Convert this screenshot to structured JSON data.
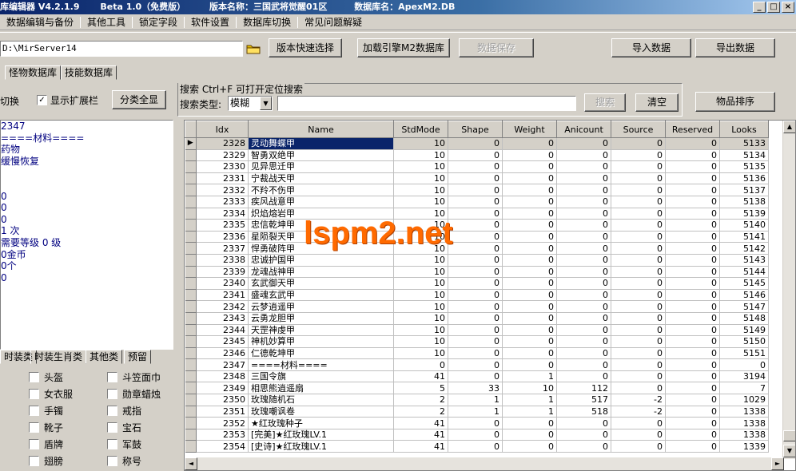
{
  "titlebar": {
    "app": "库编辑器 V4.2.1.9",
    "beta": "Beta 1.0（免费版）",
    "version": "版本名称：三国武将觉醒01区",
    "db": "数据库名：ApexM2.DB",
    "min": "_",
    "max": "□",
    "close": "×"
  },
  "menu": [
    "数据编辑与备份",
    "其他工具",
    "锁定字段",
    "软件设置",
    "数据库切换",
    "常见问题解疑"
  ],
  "toolbar": {
    "path": "D:\\MirServer14",
    "quick_select": "版本快速选择",
    "load_engine": "加载引擎M2数据库",
    "save_data": "数据保存",
    "import": "导入数据",
    "export": "导出数据"
  },
  "tabs": [
    "怪物数据库",
    "技能数据库"
  ],
  "left_top": {
    "switch_label": "切换",
    "show_ext": "显示扩展栏",
    "show_ext_checked": "✓",
    "show_all": "分类全显"
  },
  "search": {
    "title": "搜索  Ctrl+F 可打开定位搜索",
    "type_label": "搜索类型:",
    "type_value": "模糊",
    "search_btn": "搜索",
    "clear_btn": "清空",
    "sort_btn": "物品排序"
  },
  "info_lines": [
    "2347",
    "====材料====",
    "药物",
    "缓慢恢复",
    "",
    "",
    "0",
    "0",
    "0",
    "1 次",
    "需要等级 0 级",
    "0金币",
    "0个",
    "0"
  ],
  "bottom_tabs": [
    "时装类",
    "时装生肖类",
    "其他类",
    "预留"
  ],
  "checklist": {
    "left": [
      "头盔",
      "女衣服",
      "手镯",
      "靴子",
      "盾牌",
      "翅膀"
    ],
    "right": [
      "斗笠面巾",
      "勋章蜡烛",
      "戒指",
      "宝石",
      "军鼓",
      "称号"
    ]
  },
  "grid": {
    "columns": [
      "Idx",
      "Name",
      "StdMode",
      "Shape",
      "Weight",
      "Anicount",
      "Source",
      "Reserved",
      "Looks"
    ],
    "rows": [
      [
        "2328",
        "灵动舞蝶甲",
        "10",
        "0",
        "0",
        "0",
        "0",
        "0",
        "5133"
      ],
      [
        "2329",
        "智勇双绝甲",
        "10",
        "0",
        "0",
        "0",
        "0",
        "0",
        "5134"
      ],
      [
        "2330",
        "见异思迁甲",
        "10",
        "0",
        "0",
        "0",
        "0",
        "0",
        "5135"
      ],
      [
        "2331",
        "宁裁战天甲",
        "10",
        "0",
        "0",
        "0",
        "0",
        "0",
        "5136"
      ],
      [
        "2332",
        "不羚不伤甲",
        "10",
        "0",
        "0",
        "0",
        "0",
        "0",
        "5137"
      ],
      [
        "2333",
        "疾风战意甲",
        "10",
        "0",
        "0",
        "0",
        "0",
        "0",
        "5138"
      ],
      [
        "2334",
        "炽焰熔岩甲",
        "10",
        "0",
        "0",
        "0",
        "0",
        "0",
        "5139"
      ],
      [
        "2335",
        "忠信乾坤甲",
        "10",
        "0",
        "0",
        "0",
        "0",
        "0",
        "5140"
      ],
      [
        "2336",
        "星陨裂天甲",
        "10",
        "0",
        "0",
        "0",
        "0",
        "0",
        "5141"
      ],
      [
        "2337",
        "悍勇破阵甲",
        "10",
        "0",
        "0",
        "0",
        "0",
        "0",
        "5142"
      ],
      [
        "2338",
        "忠诚护国甲",
        "10",
        "0",
        "0",
        "0",
        "0",
        "0",
        "5143"
      ],
      [
        "2339",
        "龙魂战神甲",
        "10",
        "0",
        "0",
        "0",
        "0",
        "0",
        "5144"
      ],
      [
        "2340",
        "玄武御天甲",
        "10",
        "0",
        "0",
        "0",
        "0",
        "0",
        "5145"
      ],
      [
        "2341",
        "盛魂玄武甲",
        "10",
        "0",
        "0",
        "0",
        "0",
        "0",
        "5146"
      ],
      [
        "2342",
        "云梦逍遥甲",
        "10",
        "0",
        "0",
        "0",
        "0",
        "0",
        "5147"
      ],
      [
        "2343",
        "云勇龙胆甲",
        "10",
        "0",
        "0",
        "0",
        "0",
        "0",
        "5148"
      ],
      [
        "2344",
        "天罡神虔甲",
        "10",
        "0",
        "0",
        "0",
        "0",
        "0",
        "5149"
      ],
      [
        "2345",
        "神机妙算甲",
        "10",
        "0",
        "0",
        "0",
        "0",
        "0",
        "5150"
      ],
      [
        "2346",
        "仁德乾坤甲",
        "10",
        "0",
        "0",
        "0",
        "0",
        "0",
        "5151"
      ],
      [
        "2347",
        "====材料====",
        "0",
        "0",
        "0",
        "0",
        "0",
        "0",
        "0"
      ],
      [
        "2348",
        "三国令旗",
        "41",
        "0",
        "1",
        "0",
        "0",
        "0",
        "3194"
      ],
      [
        "2349",
        "相思熊逍遥扇",
        "5",
        "33",
        "10",
        "112",
        "0",
        "0",
        "7"
      ],
      [
        "2350",
        "玫瑰随机石",
        "2",
        "1",
        "1",
        "517",
        "-2",
        "0",
        "1029"
      ],
      [
        "2351",
        "玫瑰嘲讽卷",
        "2",
        "1",
        "1",
        "518",
        "-2",
        "0",
        "1338"
      ],
      [
        "2352",
        "★红玫瑰种子",
        "41",
        "0",
        "0",
        "0",
        "0",
        "0",
        "1338"
      ],
      [
        "2353",
        "[完美]★红玫瑰LV.1",
        "41",
        "0",
        "0",
        "0",
        "0",
        "0",
        "1338"
      ],
      [
        "2354",
        "[史诗]★红玫瑰LV.1",
        "41",
        "0",
        "0",
        "0",
        "0",
        "0",
        "1339"
      ]
    ]
  },
  "watermark": "lspm2.net",
  "scroll": {
    "up": "▲",
    "down": "▼",
    "left": "◄",
    "right": "►",
    "row_pointer": "▶"
  }
}
